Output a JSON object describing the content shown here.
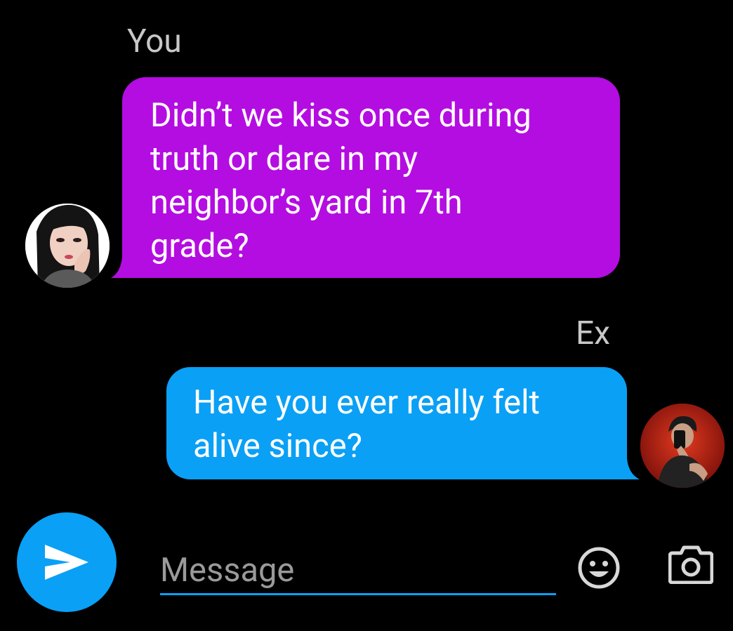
{
  "conversation": {
    "messages": [
      {
        "sender": "You",
        "side": "left",
        "text": "Didn’t we kiss once during\ntruth or dare in my\nneighbor’s yard in 7th\ngrade?",
        "bubble_color": "#b40de1"
      },
      {
        "sender": "Ex",
        "side": "right",
        "text": "Have you ever really felt\nalive since?",
        "bubble_color": "#0aa0f5"
      }
    ]
  },
  "composer": {
    "placeholder": "Message",
    "value": "",
    "send_icon": "send-arrow-icon",
    "emoji_icon": "smiley-face-icon",
    "camera_icon": "camera-icon",
    "accent_color": "#0aa0f5"
  }
}
